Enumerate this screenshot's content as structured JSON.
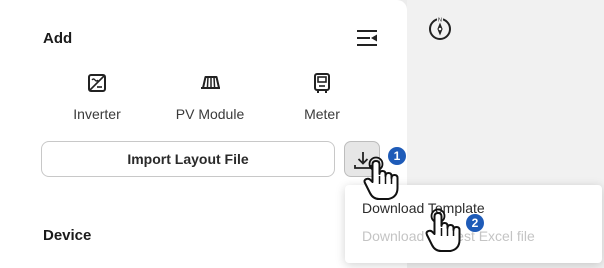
{
  "add_section": {
    "title": "Add",
    "collapse_icon": "collapse-panel-icon",
    "items": [
      {
        "label": "Inverter",
        "icon": "inverter-icon"
      },
      {
        "label": "PV Module",
        "icon": "pv-module-icon"
      },
      {
        "label": "Meter",
        "icon": "meter-icon"
      }
    ]
  },
  "import": {
    "button_label": "Import Layout File",
    "download_icon": "download-icon"
  },
  "device_section": {
    "title": "Device"
  },
  "download_menu": {
    "items": [
      {
        "label": "Download Template",
        "enabled": true
      },
      {
        "label": "Download Newest Excel file",
        "enabled": false
      }
    ]
  },
  "steps": [
    {
      "number": "1",
      "target": "download-button"
    },
    {
      "number": "2",
      "target": "download-template-item"
    }
  ],
  "map": {
    "compass_icon": "compass-icon"
  },
  "colors": {
    "step_badge": "#1e5bb8",
    "disabled_text": "#c4c4c4",
    "download_button_bg": "#e6e6e6"
  }
}
